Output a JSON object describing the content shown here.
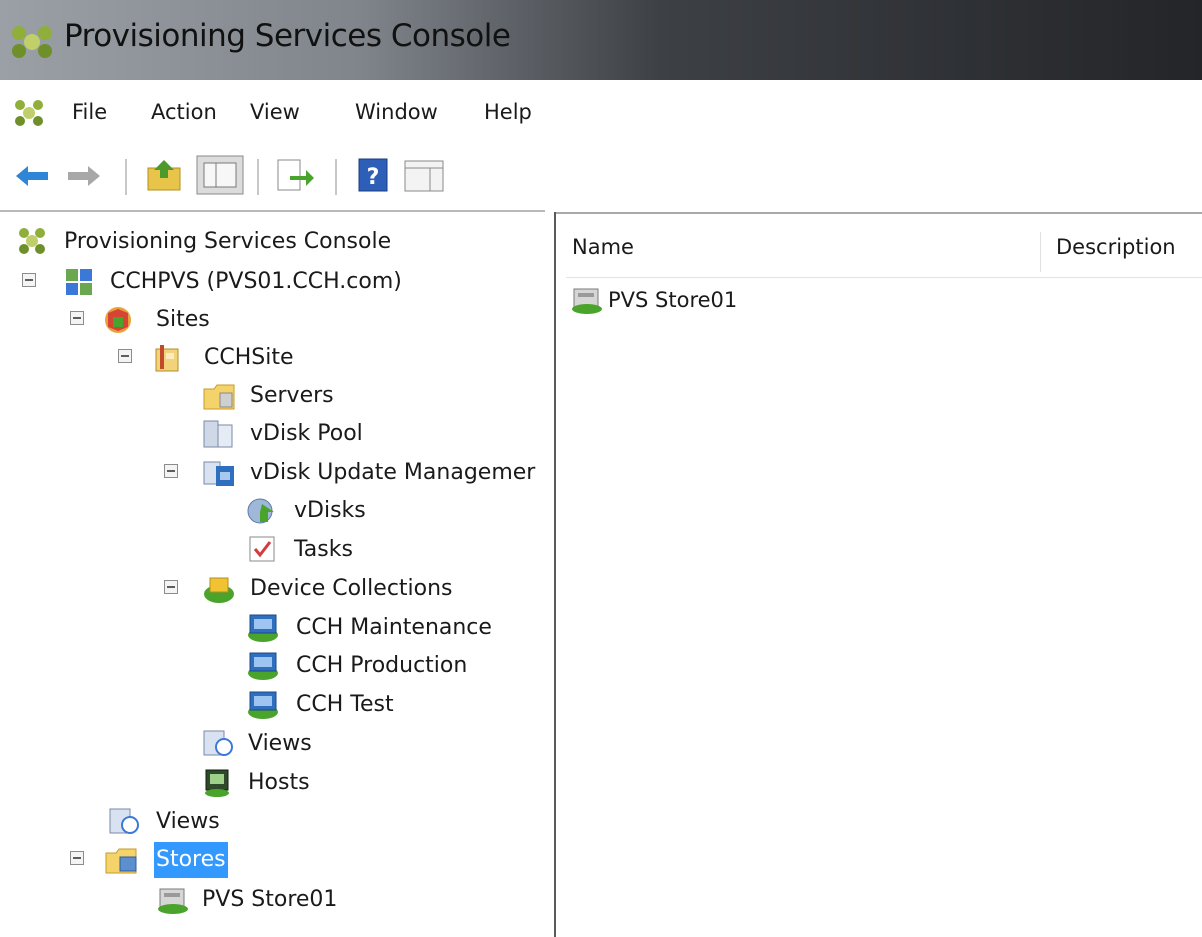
{
  "window": {
    "title": "Provisioning Services Console"
  },
  "menu": [
    "File",
    "Action",
    "View",
    "Window",
    "Help"
  ],
  "toolbar": {
    "buttons": [
      "back-arrow-icon",
      "forward-arrow-icon",
      "up-folder-icon",
      "show-hide-tree-icon",
      "export-list-icon",
      "help-icon",
      "show-hide-action-pane-icon"
    ]
  },
  "tree": {
    "root": "Provisioning Services Console",
    "farm": "CCHPVS (PVS01.CCH.com)",
    "sites": "Sites",
    "site": "CCHSite",
    "servers": "Servers",
    "vdisk_pool": "vDisk Pool",
    "vdisk_update": "vDisk Update Managemer",
    "vdisks": "vDisks",
    "tasks": "Tasks",
    "device_collections": "Device Collections",
    "collections": [
      "CCH Maintenance",
      "CCH Production",
      "CCH Test"
    ],
    "site_views": "Views",
    "hosts": "Hosts",
    "farm_views": "Views",
    "stores": "Stores",
    "store": "PVS Store01"
  },
  "list": {
    "columns": [
      "Name",
      "Description"
    ],
    "items": [
      "PVS Store01"
    ]
  },
  "colors": {
    "selection": "#3399ff",
    "titlebar_dark": "#232528"
  }
}
